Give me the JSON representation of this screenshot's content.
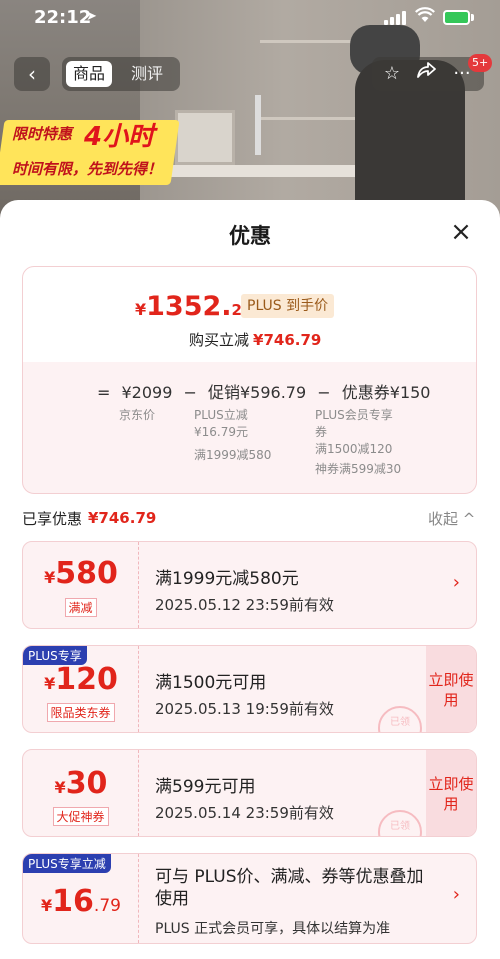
{
  "status_bar": {
    "time": "22:12",
    "location_arrow": "➤"
  },
  "promo": {
    "line1": "限时特惠",
    "big": "4小时",
    "line2": "时间有限，先到先得！"
  },
  "nav": {
    "tabs": [
      "商品",
      "测评"
    ],
    "badge": "5+",
    "icons": [
      "back-icon",
      "star-icon",
      "share-icon",
      "more-icon"
    ]
  },
  "sheet": {
    "title": "优惠",
    "summary": {
      "currency": "¥",
      "price_int": "1352.",
      "price_dec": "21",
      "plus_tag": "PLUS 到手价",
      "reduce_label": "购买立减",
      "reduce_amount": "¥746.79",
      "formula": {
        "eq": "=",
        "jd_price": "¥2099",
        "minus1": "−",
        "promo": "促销¥596.79",
        "minus2": "−",
        "coupon": "优惠券¥150"
      },
      "jd_label": "京东价",
      "promo_details": [
        "PLUS立减",
        "¥16.79元",
        "满1999减580"
      ],
      "coupon_details": [
        "PLUS会员专享",
        "券",
        "满1500减120",
        "神券满599减30"
      ]
    },
    "enjoyed": {
      "label": "已享优惠",
      "amount": "¥746.79",
      "collapse": "收起 ^"
    },
    "cards": [
      {
        "currency": "¥",
        "value": "580",
        "kind": "满减",
        "title": "满1999元减580元",
        "expire": "2025.05.12 23:59前有效"
      },
      {
        "corner": "PLUS专享",
        "currency": "¥",
        "value": "120",
        "kind": "限品类东券",
        "title": "满1500元可用",
        "expire": "2025.05.13 19:59前有效",
        "action": "立即使用",
        "stamp": "已领"
      },
      {
        "currency": "¥",
        "value": "30",
        "kind": "大促神券",
        "title": "满599元可用",
        "expire": "2025.05.14 23:59前有效",
        "action": "立即使用",
        "stamp": "已领"
      },
      {
        "corner": "PLUS专享立减",
        "currency": "¥",
        "value": "16",
        "decimal": ".79",
        "title": "可与 PLUS价、满减、券等优惠叠加使用",
        "title_line1": "可与 PLUS价、满减、券等优惠叠加",
        "title_line2": "使用",
        "expire": "PLUS 正式会员可享，具体以结算为准"
      }
    ]
  },
  "colors": {
    "accent": "#e1251b",
    "plus_blue": "#2c3fb0",
    "card_bg": "#fdf2f3"
  }
}
